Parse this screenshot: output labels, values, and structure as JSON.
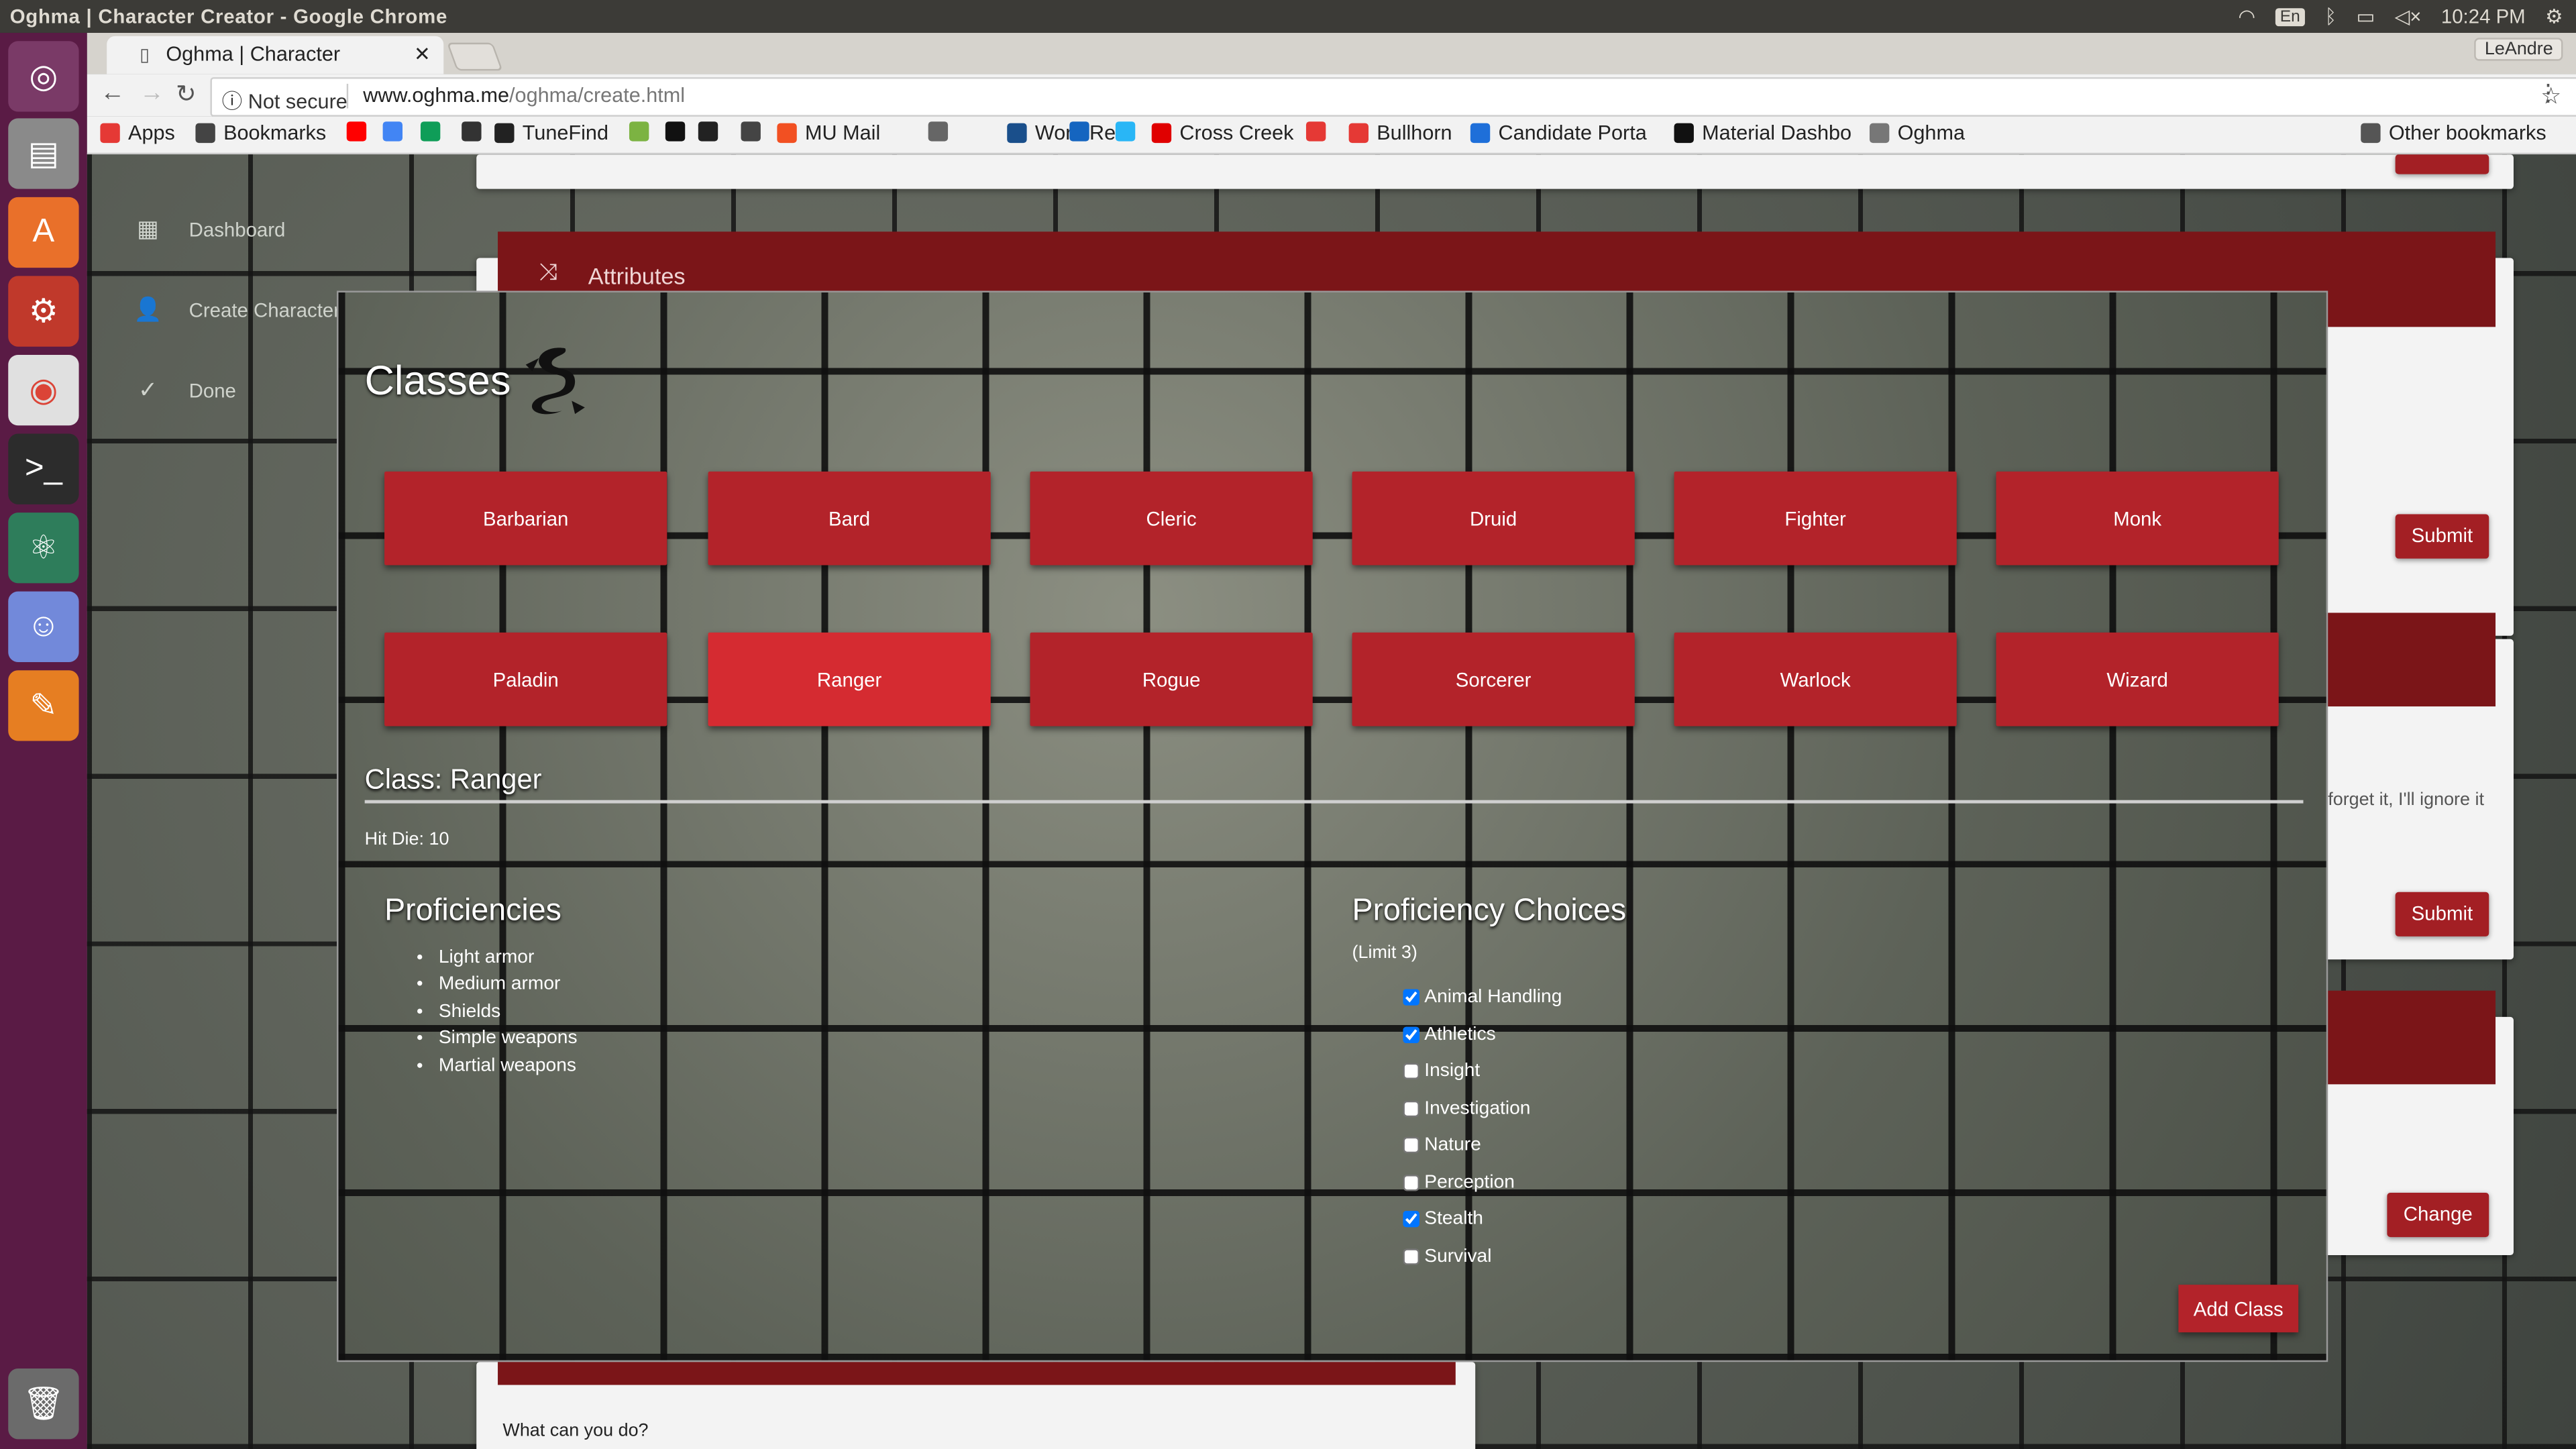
{
  "system": {
    "window_title": "Oghma | Character Creator - Google Chrome",
    "lang": "En",
    "time": "10:24 PM"
  },
  "browser": {
    "tab_title": "Oghma | Character",
    "user_button": "LeAndre",
    "security": "Not secure",
    "url_host": "www.oghma.me",
    "url_path": "/oghma/create.html"
  },
  "bookmarks": [
    {
      "label": "Apps",
      "color": "#e53935"
    },
    {
      "label": "Bookmarks",
      "color": "#444444"
    },
    {
      "label": "",
      "color": "#ff0000"
    },
    {
      "label": "",
      "color": "#4285f4"
    },
    {
      "label": "",
      "color": "#0f9d58"
    },
    {
      "label": "",
      "color": "#333333"
    },
    {
      "label": "TuneFind",
      "color": "#222222"
    },
    {
      "label": "",
      "color": "#7cb342"
    },
    {
      "label": "",
      "color": "#111111"
    },
    {
      "label": "",
      "color": "#222222"
    },
    {
      "label": "",
      "color": "#444444"
    },
    {
      "label": "MU Mail",
      "color": "#f25022"
    },
    {
      "label": "",
      "color": "#666666"
    },
    {
      "label": "Word Ref",
      "color": "#1a4f8b"
    },
    {
      "label": "",
      "color": "#1565c0"
    },
    {
      "label": "",
      "color": "#29b6f6"
    },
    {
      "label": "Cross Creek",
      "color": "#e00000"
    },
    {
      "label": "",
      "color": "#e53935"
    },
    {
      "label": "Bullhorn",
      "color": "#e53935"
    },
    {
      "label": "Candidate Porta",
      "color": "#1e6fd9"
    },
    {
      "label": "Material Dashbo",
      "color": "#111111"
    },
    {
      "label": "Oghma",
      "color": "#777777"
    },
    {
      "label": "Other bookmarks",
      "color": "#555555"
    }
  ],
  "sidebar": {
    "items": [
      {
        "label": "Dashboard",
        "icon": "dashboard-icon"
      },
      {
        "label": "Create Character",
        "icon": "person-add-icon"
      },
      {
        "label": "Done",
        "icon": "check-icon"
      }
    ]
  },
  "background": {
    "attributes_title": "Attributes",
    "submit_label": "Submit",
    "change_label": "Change",
    "hint_text": "forget it, I'll ignore it",
    "footer_question": "What can you do?"
  },
  "modal": {
    "title": "Classes",
    "classes": [
      "Barbarian",
      "Bard",
      "Cleric",
      "Druid",
      "Fighter",
      "Monk",
      "Paladin",
      "Ranger",
      "Rogue",
      "Sorcerer",
      "Warlock",
      "Wizard"
    ],
    "selected_class": "Ranger",
    "class_heading": "Class: Ranger",
    "hit_die": "Hit Die: 10",
    "proficiencies_title": "Proficiencies",
    "proficiencies": [
      "Light armor",
      "Medium armor",
      "Shields",
      "Simple weapons",
      "Martial weapons"
    ],
    "choices_title": "Proficiency Choices",
    "choices_limit": "(Limit 3)",
    "choices": [
      {
        "label": "Animal Handling",
        "checked": true
      },
      {
        "label": "Athletics",
        "checked": true
      },
      {
        "label": "Insight",
        "checked": false
      },
      {
        "label": "Investigation",
        "checked": false
      },
      {
        "label": "Nature",
        "checked": false
      },
      {
        "label": "Perception",
        "checked": false
      },
      {
        "label": "Stealth",
        "checked": true
      },
      {
        "label": "Survival",
        "checked": false
      }
    ],
    "add_button": "Add Class"
  },
  "colors": {
    "accent_red": "#b3232a",
    "selected_red": "#d52b31",
    "launcher": "#5a1b45"
  }
}
